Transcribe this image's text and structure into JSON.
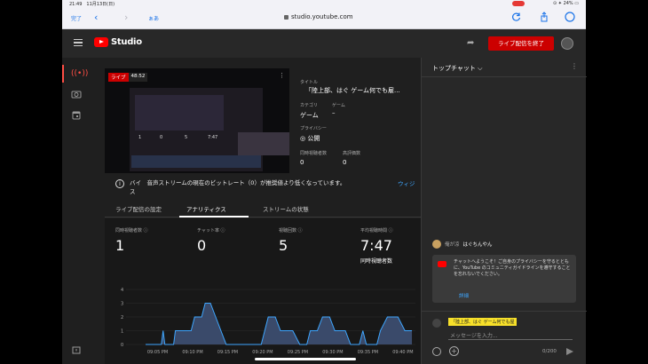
{
  "status_bar": {
    "time": "21:49　11月13日(日)",
    "system": "⊙ ✦ 24% ▭"
  },
  "browser": {
    "done": "完了",
    "back": "‹",
    "forward": "›",
    "reader": "ぁあ",
    "url": "studio.youtube.com"
  },
  "header": {
    "logo": "Studio",
    "end_stream": "ライブ配信を終了",
    "share": "➦"
  },
  "preview": {
    "live_label": "ライブ",
    "duration": "48:52",
    "inner_stats": [
      "1",
      "0",
      "5",
      "7:47"
    ]
  },
  "info": {
    "title_label": "タイトル",
    "title": "「陸上部、はぐ ゲーム何でも雇...",
    "category_label": "カテゴリ",
    "category": "ゲーム",
    "game_label": "ゲーム",
    "game": "–",
    "privacy_label": "プライバシー",
    "privacy": "公開",
    "concurrent_label": "同時視聴者数",
    "concurrent": "0",
    "likes_label": "高評価数",
    "likes": "0"
  },
  "warning": {
    "text": "バイ　音声ストリームの現在のビットレート（0）が推奨値より低くなっています。",
    "text2": "ス",
    "link": "ウィジ"
  },
  "tabs": [
    "ライブ配信の設定",
    "アナリティクス",
    "ストリームの状態"
  ],
  "stats": [
    {
      "label": "同時視聴者数",
      "value": "1",
      "sub": ""
    },
    {
      "label": "チャット率",
      "value": "0",
      "sub": ""
    },
    {
      "label": "視聴回数",
      "value": "5",
      "sub": ""
    },
    {
      "label": "平均視聴時間",
      "value": "7:47",
      "sub": "同時視聴者数"
    }
  ],
  "chat": {
    "title": "トップチャット ⌵",
    "user_name": "俺が凉",
    "user_text": "はぐちんやん",
    "welcome": "チャットへようこそ！ご自身のプライバシーを守るとともに、YouTube のコミュニティガイドラインを遵守することを忘れないでください。",
    "learn_more": "詳細",
    "tag": "「陸上部、はぐ ゲーム何でも屋",
    "placeholder": "メッセージを入力...",
    "counter": "0/200"
  },
  "chart_data": {
    "type": "area",
    "x": [
      "09:05 PM",
      "09:10 PM",
      "09:15 PM",
      "09:20 PM",
      "09:25 PM",
      "09:30 PM",
      "09:35 PM",
      "09:40 PM"
    ],
    "ylim": [
      0,
      4
    ],
    "yticks": [
      0,
      1,
      2,
      3,
      4
    ],
    "points": [
      [
        0,
        0
      ],
      [
        0.45,
        0
      ],
      [
        0.5,
        1
      ],
      [
        0.55,
        0
      ],
      [
        0.8,
        0
      ],
      [
        0.85,
        1
      ],
      [
        1.3,
        1
      ],
      [
        1.4,
        2
      ],
      [
        1.6,
        2
      ],
      [
        1.7,
        3
      ],
      [
        1.85,
        3
      ],
      [
        2.0,
        2
      ],
      [
        2.15,
        1
      ],
      [
        2.3,
        0
      ],
      [
        3.3,
        0
      ],
      [
        3.4,
        1
      ],
      [
        3.5,
        2
      ],
      [
        3.7,
        2
      ],
      [
        3.85,
        1
      ],
      [
        4.2,
        1
      ],
      [
        4.4,
        0
      ],
      [
        4.6,
        0
      ],
      [
        4.7,
        1
      ],
      [
        4.9,
        1
      ],
      [
        5.05,
        2
      ],
      [
        5.25,
        2
      ],
      [
        5.4,
        1
      ],
      [
        5.7,
        1
      ],
      [
        5.85,
        0
      ],
      [
        6.1,
        0
      ],
      [
        6.2,
        1
      ],
      [
        6.3,
        0
      ],
      [
        6.6,
        0
      ],
      [
        6.7,
        1
      ],
      [
        6.9,
        2
      ],
      [
        7.2,
        2
      ],
      [
        7.4,
        1
      ],
      [
        7.6,
        1
      ]
    ],
    "colors": {
      "line": "#3ea6ff",
      "fill": "#3a4a6a"
    }
  }
}
